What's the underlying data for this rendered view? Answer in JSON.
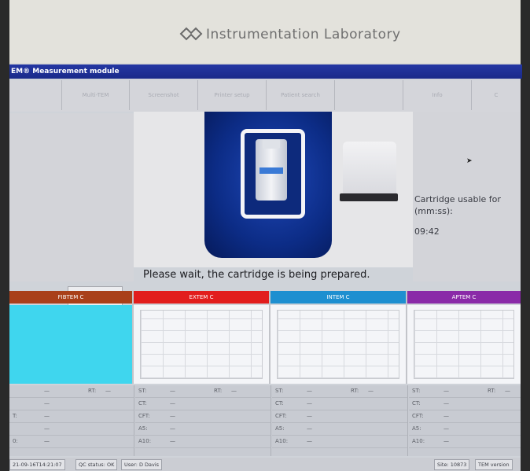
{
  "brand": {
    "name": "Instrumentation Laboratory"
  },
  "window": {
    "title": "EM® Measurement module"
  },
  "toolbar": {
    "buttons": [
      {
        "label": ""
      },
      {
        "label": "Multi-TEM"
      },
      {
        "label": "Screenshot"
      },
      {
        "label": "Printer setup"
      },
      {
        "label": "Patient search"
      },
      {
        "label": ""
      },
      {
        "label": "Info"
      },
      {
        "label": "C"
      }
    ]
  },
  "left_panel": {
    "close_label": "✕"
  },
  "cartridge": {
    "usable_label": "Cartridge usable for (mm:ss):",
    "usable_time": "09:42",
    "message": "Please wait, the cartridge is being prepared."
  },
  "channels": [
    {
      "name": "FIBTEM C",
      "color": "#a9401a"
    },
    {
      "name": "EXTEM C",
      "color": "#e21d1d"
    },
    {
      "name": "INTEM C",
      "color": "#1e8fd0"
    },
    {
      "name": "APTEM C",
      "color": "#8a2aa8"
    }
  ],
  "params": {
    "rows": [
      "ST:",
      "CT:",
      "CFT:",
      "A5:",
      "A10:"
    ],
    "rt_label": "RT:",
    "dash": "—"
  },
  "status": {
    "datetime": "21-09-16T14:21:07",
    "qc": "QC status: OK",
    "user": "User: D Davis",
    "site": "Site: 10873",
    "right": "TEM version"
  },
  "colors": {
    "titlebar": "#2437a3",
    "accent_blue": "#0c2c86",
    "fibtem_fill": "#3fd6ee"
  }
}
